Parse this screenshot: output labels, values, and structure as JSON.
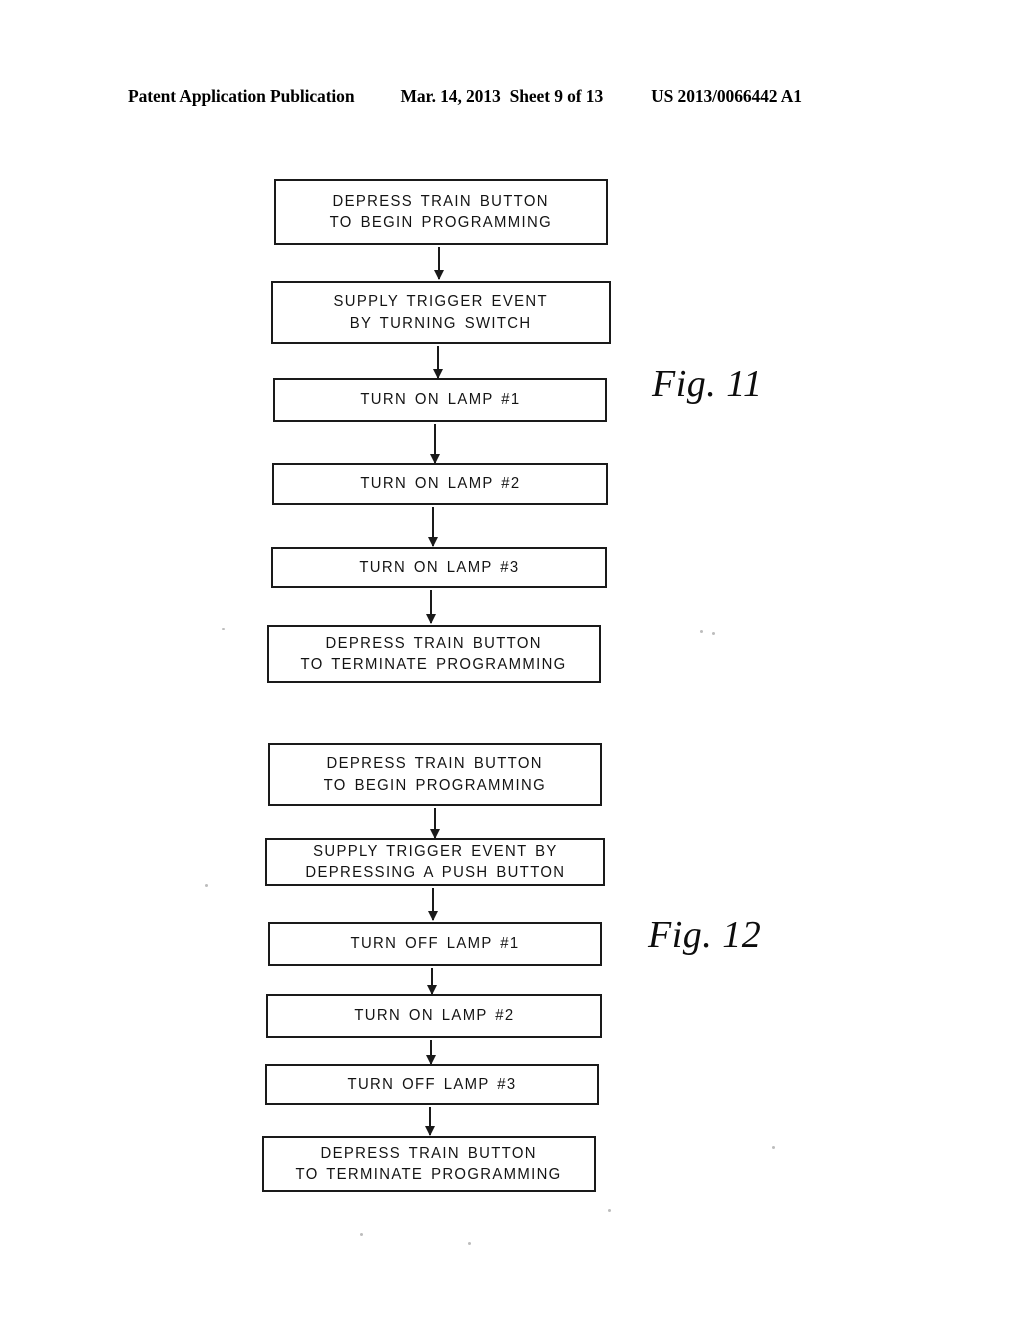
{
  "header": {
    "publication": "Patent Application Publication",
    "date": "Mar. 14, 2013",
    "sheet": "Sheet 9 of 13",
    "patent_number": "US 2013/0066442 A1"
  },
  "figures": [
    {
      "id": "fig-11",
      "caption": "Fig. 11",
      "steps": [
        {
          "lines": [
            "DEPRESS TRAIN BUTTON",
            "TO BEGIN PROGRAMMING"
          ]
        },
        {
          "lines": [
            "SUPPLY TRIGGER EVENT",
            "BY TURNING SWITCH"
          ]
        },
        {
          "lines": [
            "TURN ON LAMP #1"
          ]
        },
        {
          "lines": [
            "TURN ON LAMP #2"
          ]
        },
        {
          "lines": [
            "TURN ON LAMP #3"
          ]
        },
        {
          "lines": [
            "DEPRESS TRAIN BUTTON",
            "TO TERMINATE PROGRAMMING"
          ]
        }
      ]
    },
    {
      "id": "fig-12",
      "caption": "Fig. 12",
      "steps": [
        {
          "lines": [
            "DEPRESS TRAIN BUTTON",
            "TO BEGIN PROGRAMMING"
          ]
        },
        {
          "lines": [
            "SUPPLY TRIGGER EVENT BY",
            "DEPRESSING A PUSH BUTTON"
          ]
        },
        {
          "lines": [
            "TURN OFF LAMP #1"
          ]
        },
        {
          "lines": [
            "TURN ON LAMP #2"
          ]
        },
        {
          "lines": [
            "TURN OFF LAMP #3"
          ]
        },
        {
          "lines": [
            "DEPRESS TRAIN BUTTON",
            "TO TERMINATE PROGRAMMING"
          ]
        }
      ]
    }
  ],
  "colors": {
    "ink": "#1a1a1a",
    "paper": "#ffffff"
  }
}
